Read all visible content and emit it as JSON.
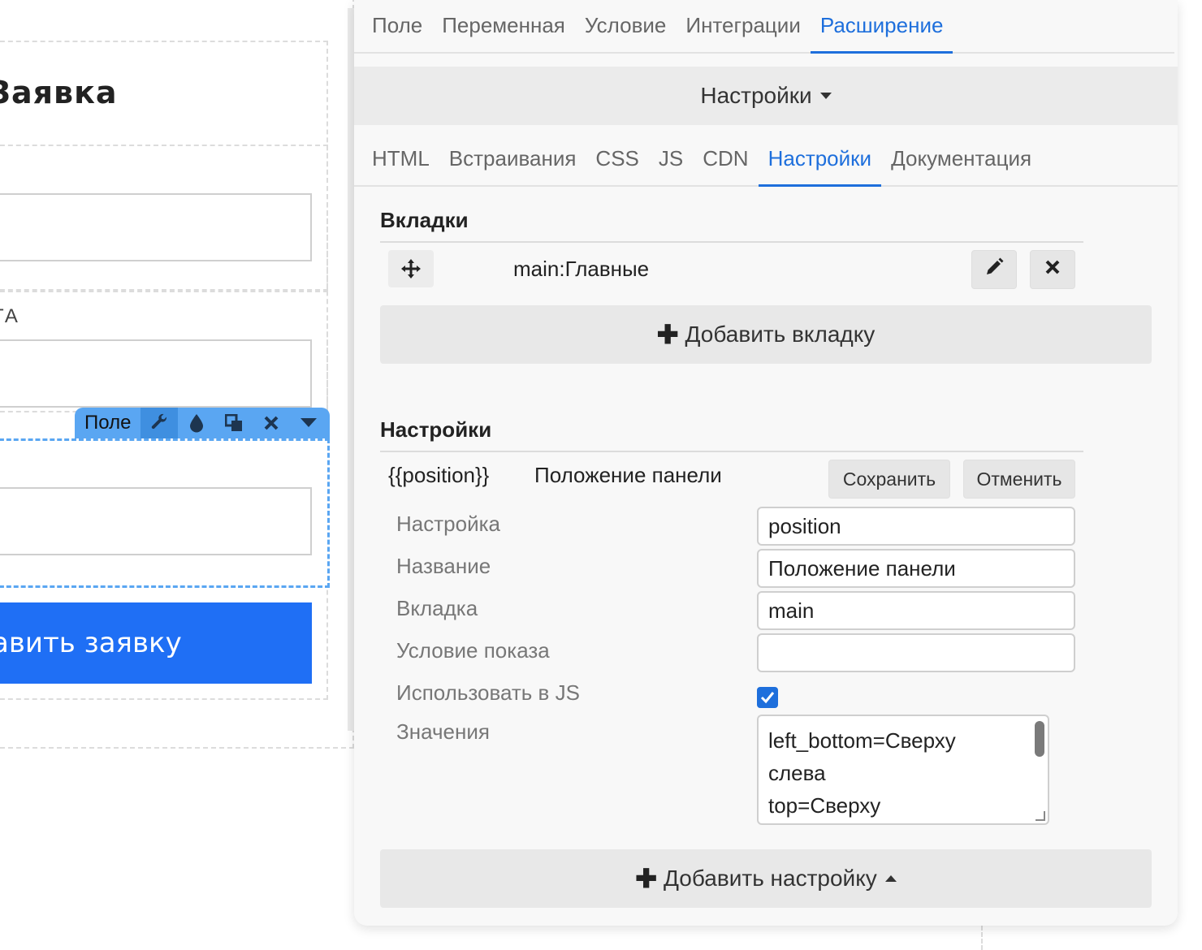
{
  "canvas": {
    "form_title": "Заявка",
    "field_label_2": "ТА",
    "toolbar": {
      "label": "Поле",
      "icons": [
        "wrench-icon",
        "drop-icon",
        "copy-icon",
        "close-icon",
        "caret-down-icon"
      ]
    },
    "submit_label": "авить заявку"
  },
  "panel": {
    "top_tabs": [
      {
        "label": "Поле"
      },
      {
        "label": "Переменная"
      },
      {
        "label": "Условие"
      },
      {
        "label": "Интеграции"
      },
      {
        "label": "Расширение",
        "active": true
      }
    ],
    "settings_dropdown": "Настройки",
    "sub_tabs": [
      {
        "label": "HTML"
      },
      {
        "label": "Встраивания"
      },
      {
        "label": "CSS"
      },
      {
        "label": "JS"
      },
      {
        "label": "CDN"
      },
      {
        "label": "Настройки",
        "active": true
      },
      {
        "label": "Документация"
      }
    ],
    "tabs_section": {
      "heading": "Вкладки",
      "items": [
        {
          "text": "main:Главные"
        }
      ],
      "add_label": "Добавить вкладку"
    },
    "settings_section": {
      "heading": "Настройки",
      "var_name": "{{position}}",
      "var_title": "Положение панели",
      "save_label": "Сохранить",
      "cancel_label": "Отменить",
      "fields": {
        "setting": {
          "label": "Настройка",
          "value": "position"
        },
        "name": {
          "label": "Название",
          "value": "Положение панели"
        },
        "tab": {
          "label": "Вкладка",
          "value": "main"
        },
        "condition": {
          "label": "Условие показа",
          "value": ""
        },
        "use_js": {
          "label": "Использовать в JS",
          "checked": true
        },
        "values": {
          "label": "Значения",
          "lines": [
            "left_bottom=Сверху",
            "слева",
            "top=Сверху"
          ]
        }
      },
      "add_label": "Добавить настройку"
    }
  },
  "colors": {
    "accent": "#1e6fdc",
    "submit": "#1f6ff5",
    "toolbar": "#5aa6f2"
  }
}
